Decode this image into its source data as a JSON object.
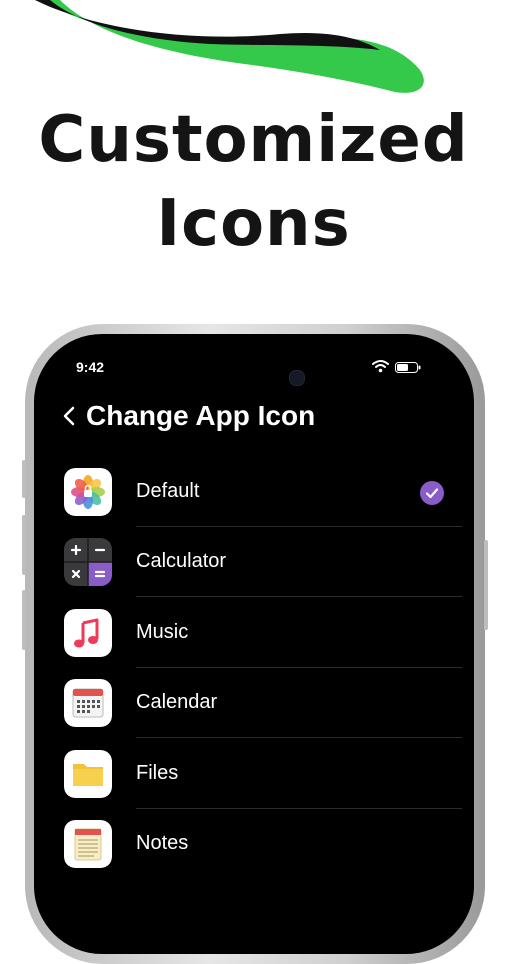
{
  "headline": {
    "line1": "Customized",
    "line2": "Icons"
  },
  "colors": {
    "accent_green": "#34c94a",
    "check_purple": "#8a5cc8",
    "screen_bg": "#000000"
  },
  "status_bar": {
    "time": "9:42",
    "icons": [
      "wifi-icon",
      "battery-icon"
    ]
  },
  "nav": {
    "back_icon": "chevron-left-icon",
    "title": "Change App Icon"
  },
  "icons_list": [
    {
      "label": "Default",
      "icon": "photos-icon",
      "selected": true
    },
    {
      "label": "Calculator",
      "icon": "calculator-icon",
      "selected": false
    },
    {
      "label": "Music",
      "icon": "music-icon",
      "selected": false
    },
    {
      "label": "Calendar",
      "icon": "calendar-icon",
      "selected": false
    },
    {
      "label": "Files",
      "icon": "files-icon",
      "selected": false
    },
    {
      "label": "Notes",
      "icon": "notes-icon",
      "selected": false
    }
  ]
}
